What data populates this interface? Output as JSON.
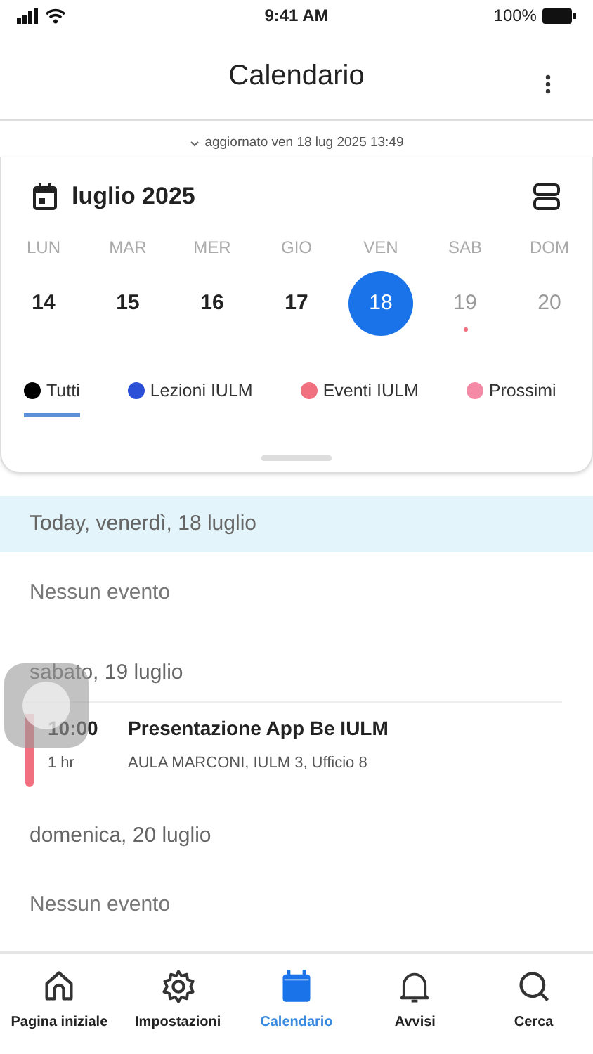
{
  "status_bar": {
    "time": "9:41 AM",
    "battery": "100%"
  },
  "header": {
    "title": "Calendario"
  },
  "updated": "aggiornato ven 18 lug 2025 13:49",
  "month": "luglio 2025",
  "weekdays": [
    "LUN",
    "MAR",
    "MER",
    "GIO",
    "VEN",
    "SAB",
    "DOM"
  ],
  "days": [
    {
      "label": "14",
      "selected": false,
      "muted": false,
      "has_event": false
    },
    {
      "label": "15",
      "selected": false,
      "muted": false,
      "has_event": false
    },
    {
      "label": "16",
      "selected": false,
      "muted": false,
      "has_event": false
    },
    {
      "label": "17",
      "selected": false,
      "muted": false,
      "has_event": false
    },
    {
      "label": "18",
      "selected": true,
      "muted": false,
      "has_event": false
    },
    {
      "label": "19",
      "selected": false,
      "muted": true,
      "has_event": true
    },
    {
      "label": "20",
      "selected": false,
      "muted": true,
      "has_event": false
    }
  ],
  "filters": [
    {
      "label": "Tutti",
      "color": "#000000",
      "selected": true
    },
    {
      "label": "Lezioni IULM",
      "color": "#2b4fd6",
      "selected": false
    },
    {
      "label": "Eventi IULM",
      "color": "#f07080",
      "selected": false
    },
    {
      "label": "Prossimi",
      "color": "#f48aa6",
      "selected": false
    }
  ],
  "agenda": [
    {
      "kind": "day",
      "label": "Today, venerdì, 18 luglio",
      "today": true
    },
    {
      "kind": "empty",
      "label": "Nessun evento"
    },
    {
      "kind": "day",
      "label": "sabato, 19 luglio",
      "today": false
    },
    {
      "kind": "event",
      "time": "10:00",
      "duration": "1 hr",
      "title": "Presentazione App Be IULM",
      "location": "AULA MARCONI, IULM 3, Ufficio 8",
      "color": "#f07080"
    },
    {
      "kind": "day",
      "label": "domenica, 20 luglio",
      "today": false
    },
    {
      "kind": "empty",
      "label": "Nessun evento"
    }
  ],
  "nav": [
    {
      "label": "Pagina iniziale",
      "kind": "home",
      "selected": false
    },
    {
      "label": "Impostazioni",
      "kind": "settings",
      "selected": false
    },
    {
      "label": "Calendario",
      "kind": "calendar",
      "selected": true
    },
    {
      "label": "Avvisi",
      "kind": "alerts",
      "selected": false
    },
    {
      "label": "Cerca",
      "kind": "search",
      "selected": false
    }
  ]
}
